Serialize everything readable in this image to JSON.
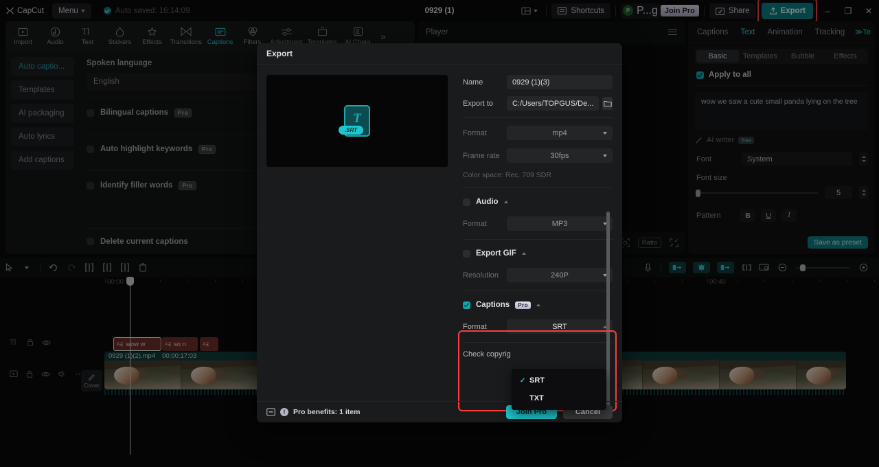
{
  "titlebar": {
    "app_name": "CapCut",
    "menu_label": "Menu",
    "autosave": "Auto saved: 16:14:09",
    "project_title": "0929 (1)",
    "shortcuts_label": "Shortcuts",
    "account_label": "P...g",
    "account_initial": "P",
    "join_pro_label": "Join Pro",
    "share_label": "Share",
    "export_label": "Export",
    "minimize": "–",
    "maximize": "❐",
    "close": "✕",
    "accent_teal": "#0e7f86",
    "highlight_red": "#fc3d3d"
  },
  "tools": [
    {
      "label": "Import",
      "icon": "import-icon",
      "active": false
    },
    {
      "label": "Audio",
      "icon": "audio-icon",
      "active": false
    },
    {
      "label": "Text",
      "icon": "text-icon",
      "active": false
    },
    {
      "label": "Stickers",
      "icon": "stickers-icon",
      "active": false
    },
    {
      "label": "Effects",
      "icon": "effects-icon",
      "active": false
    },
    {
      "label": "Transitions",
      "icon": "transitions-icon",
      "active": false
    },
    {
      "label": "Captions",
      "icon": "captions-icon",
      "active": true
    },
    {
      "label": "Filters",
      "icon": "filters-icon",
      "active": false
    },
    {
      "label": "Adjustment",
      "icon": "adjustment-icon",
      "active": false
    },
    {
      "label": "Templates",
      "icon": "templates-icon",
      "active": false
    },
    {
      "label": "AI Chara",
      "icon": "ai-character-icon",
      "active": false
    }
  ],
  "tools_more": "»",
  "left_panel": {
    "nav": [
      {
        "label": "Auto captio...",
        "active": true
      },
      {
        "label": "Templates",
        "active": false
      },
      {
        "label": "AI packaging",
        "active": false
      },
      {
        "label": "Auto lyrics",
        "active": false
      },
      {
        "label": "Add captions",
        "active": false
      }
    ],
    "spoken_language_label": "Spoken language",
    "spoken_language_value": "English",
    "options": [
      {
        "label": "Bilingual captions",
        "badge": "Pro"
      },
      {
        "label": "Auto highlight keywords",
        "badge": "Pro"
      },
      {
        "label": "Identify filler words",
        "badge": "Pro"
      }
    ],
    "delete_label": "Delete current captions"
  },
  "player": {
    "title": "Player",
    "caption_overlay": "wow we saw a cute small panda lying on the tree",
    "ratio_label": "Ratio"
  },
  "right_panel": {
    "tabs": [
      {
        "label": "Captions",
        "active": false
      },
      {
        "label": "Text",
        "active": true
      },
      {
        "label": "Animation",
        "active": false
      },
      {
        "label": "Tracking",
        "active": false
      }
    ],
    "tabs_more": "≫Te",
    "subtabs": [
      {
        "label": "Basic",
        "active": true
      },
      {
        "label": "Templates",
        "active": false
      },
      {
        "label": "Bubble",
        "active": false
      },
      {
        "label": "Effects",
        "active": false
      }
    ],
    "apply_to_all": "Apply to all",
    "text_value": "wow we saw a cute small panda lying on the tree",
    "ai_writer_label": "AI writer",
    "ai_writer_badge": "free",
    "font_label": "Font",
    "font_value": "System",
    "font_size_label": "Font size",
    "font_size_value": "5",
    "pattern_label": "Pattern",
    "pattern_buttons": [
      "B",
      "U",
      "I"
    ],
    "save_preset_label": "Save as preset"
  },
  "timeline": {
    "ruler_start": "00:00",
    "ruler_mid": "00:40",
    "caption_clips": [
      {
        "text": "wow w",
        "selected": true
      },
      {
        "text": "so n",
        "selected": false
      },
      {
        "text": "",
        "selected": false
      }
    ],
    "video_clip_name": "0929 (1)(2).mp4",
    "video_clip_duration": "00:00:17:03",
    "cover_label": "Cover"
  },
  "export_dialog": {
    "title": "Export",
    "name_label": "Name",
    "name_value": "0929 (1)(3)",
    "export_to_label": "Export to",
    "export_to_value": "C:/Users/TOPGUS/De...",
    "preview_badge": ".SRT",
    "preview_letter": "T",
    "video_format_label": "Format",
    "video_format_value": "mp4",
    "frame_rate_label": "Frame rate",
    "frame_rate_value": "30fps",
    "color_space": "Color space: Rec. 709 SDR",
    "audio_label": "Audio",
    "audio_format_label": "Format",
    "audio_format_value": "MP3",
    "gif_label": "Export GIF",
    "gif_resolution_label": "Resolution",
    "gif_resolution_value": "240P",
    "captions_label": "Captions",
    "captions_badge": "Pro",
    "captions_format_label": "Format",
    "captions_format_value": "SRT",
    "check_copyright_label": "Check copyrig",
    "dropdown_options": [
      {
        "label": "SRT",
        "selected": true
      },
      {
        "label": "TXT",
        "selected": false
      }
    ],
    "pro_benefits": "Pro benefits: 1 item",
    "join_pro_label": "Join Pro",
    "cancel_label": "Cancel"
  }
}
